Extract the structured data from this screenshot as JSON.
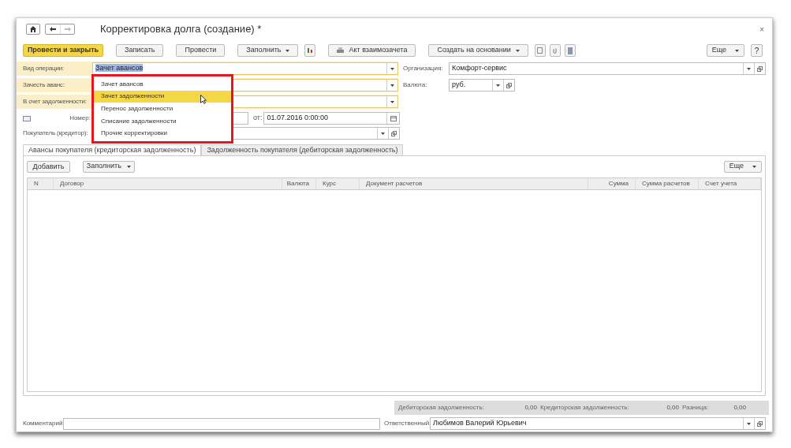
{
  "window": {
    "title": "Корректировка долга (создание) *",
    "close": "×"
  },
  "toolbar": [
    {
      "label": "Провести и закрыть",
      "kind": "primary"
    },
    {
      "label": "Записать",
      "kind": "plain"
    },
    {
      "label": "Провести",
      "kind": "plain"
    },
    {
      "label": "Заполнить",
      "kind": "menu"
    },
    {
      "label": "Акт взаимозачета",
      "kind": "print"
    },
    {
      "label": "Создать на основании",
      "kind": "menu"
    }
  ],
  "toolbar_more": {
    "label": "Еще"
  },
  "help": "?",
  "fields": [
    {
      "label": "Вид операции:",
      "value": "Зачет авансов",
      "highlighted": true
    },
    {
      "label": "Зачесть аванс:",
      "highlighted": true
    },
    {
      "label": "В счет задолженности:",
      "highlighted": true
    }
  ],
  "number": {
    "label": "Номер:",
    "date_label": "от:",
    "date": "01.07.2016  0:00:00"
  },
  "buyer": {
    "label": "Покупатель (кредитор):"
  },
  "organization": {
    "label": "Организация:",
    "value": "Комфорт-сервис"
  },
  "currency": {
    "label": "Валюта:",
    "value": "руб."
  },
  "dropdown": [
    {
      "label": "Зачет авансов",
      "selected": false
    },
    {
      "label": "Зачет задолженности",
      "selected": true
    },
    {
      "label": "Перенос задолженности",
      "selected": false
    },
    {
      "label": "Списание задолженности",
      "selected": false
    },
    {
      "label": "Прочие корректировки",
      "selected": false
    }
  ],
  "tabs": [
    {
      "label": "Авансы покупателя (кредиторская задолженность)",
      "selected": true
    },
    {
      "label": "Задолженность покупателя (дебиторская задолженность)",
      "selected": false
    }
  ],
  "table_toolbar": {
    "add": "Добавить",
    "fill": "Заполнить",
    "more": "Еще"
  },
  "table": {
    "columns": [
      "N",
      "Договор",
      "Валюта",
      "Курс",
      "Документ расчетов",
      "Сумма",
      "Сумма расчетов",
      "Счет учета"
    ]
  },
  "totals": [
    {
      "label": "Дебиторская задолженность:",
      "value": "0,00"
    },
    {
      "label": "Кредиторская задолженность:",
      "value": "0,00"
    },
    {
      "label": "Разница:",
      "value": "0,00"
    }
  ],
  "comment": {
    "label": "Комментарий:"
  },
  "responsible": {
    "label": "Ответственный:",
    "value": "Любимов Валерий Юрьевич"
  }
}
